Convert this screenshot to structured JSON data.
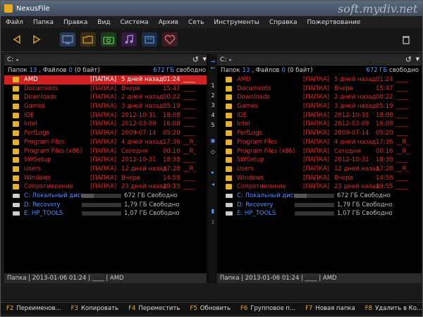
{
  "window": {
    "title": "NexusFile",
    "watermark": "soft.mydiv.net"
  },
  "menu": [
    "Файл",
    "Папка",
    "Правка",
    "Вид",
    "Система",
    "Архив",
    "Сеть",
    "Инструменты",
    "Справка",
    "Пожертвование"
  ],
  "left_panel": {
    "path": "C:",
    "stat": {
      "folders_label": "Папок",
      "folders": "13",
      "files_label": ", Файлов",
      "files": "0",
      "bytes": "(0 байт)",
      "free": "672 ГБ",
      "free_label": "свободно"
    },
    "rows": [
      {
        "name": "AMD",
        "type": "[ПАПКА]",
        "date": "5 дней назад",
        "time": "01:24",
        "attr": "____"
      },
      {
        "name": "Documents",
        "type": "[ПАПКА]",
        "date": "Вчера",
        "time": "15:47",
        "attr": "____"
      },
      {
        "name": "Downloads",
        "type": "[ПАПКА]",
        "date": "2 дней назад",
        "time": "00:22",
        "attr": "____"
      },
      {
        "name": "Games",
        "type": "[ПАПКА]",
        "date": "3 дней назад",
        "time": "05:19",
        "attr": "____"
      },
      {
        "name": "IDE",
        "type": "[ПАПКА]",
        "date": "2012-10-31",
        "time": "18:08",
        "attr": "____"
      },
      {
        "name": "Intel",
        "type": "[ПАПКА]",
        "date": "2012-03-09",
        "time": "16:08",
        "attr": "____"
      },
      {
        "name": "PerfLogs",
        "type": "[ПАПКА]",
        "date": "2009-07-14",
        "time": "05:20",
        "attr": "____"
      },
      {
        "name": "Program Files",
        "type": "[ПАПКА]",
        "date": "4 дней назад",
        "time": "17:36",
        "attr": "__R_"
      },
      {
        "name": "Program Files (x86)",
        "type": "[ПАПКА]",
        "date": "Сегодня",
        "time": "00:16",
        "attr": "__R_"
      },
      {
        "name": "SWSetup",
        "type": "[ПАПКА]",
        "date": "2012-10-31",
        "time": "18:38",
        "attr": "____"
      },
      {
        "name": "Users",
        "type": "[ПАПКА]",
        "date": "12 дней назад",
        "time": "17:28",
        "attr": "__R_"
      },
      {
        "name": "Windows",
        "type": "[ПАПКА]",
        "date": "Вчера",
        "time": "14:58",
        "attr": "____"
      },
      {
        "name": "Сопротивление",
        "type": "[ПАПКА]",
        "date": "23 дней назад",
        "time": "19:55",
        "attr": "____"
      }
    ],
    "drives": [
      {
        "name": "C: Локальный диск",
        "free": "672 ГБ Свободно",
        "used_fraction": 0.3
      },
      {
        "name": "D: Recovery",
        "free": "1,79 ГБ Свободно",
        "used_fraction": 0.0
      },
      {
        "name": "E: HP_TOOLS",
        "free": "1,07 ГБ Свободно",
        "used_fraction": 0.0
      }
    ],
    "footer": "Папка  |  2013-01-06 01:24  |  ____  |  AMD"
  },
  "right_panel": {
    "path": "C:",
    "stat": {
      "folders_label": "Папок",
      "folders": "13",
      "files_label": ", Файлов",
      "files": "0",
      "bytes": "(0 байт)",
      "free": "672 ГБ",
      "free_label": "свободно"
    },
    "rows": [
      {
        "name": "AMD",
        "type": "[ПАПКА]",
        "date": "5 дней назад",
        "time": "01:24",
        "attr": "____"
      },
      {
        "name": "Documents",
        "type": "[ПАПКА]",
        "date": "Вчера",
        "time": "15:47",
        "attr": "____"
      },
      {
        "name": "Downloads",
        "type": "[ПАПКА]",
        "date": "2 дней назад",
        "time": "00:22",
        "attr": "____"
      },
      {
        "name": "Games",
        "type": "[ПАПКА]",
        "date": "3 дней назад",
        "time": "05:19",
        "attr": "____"
      },
      {
        "name": "IDE",
        "type": "[ПАПКА]",
        "date": "2012-10-31",
        "time": "18:08",
        "attr": "____"
      },
      {
        "name": "Intel",
        "type": "[ПАПКА]",
        "date": "2012-03-09",
        "time": "16:08",
        "attr": "____"
      },
      {
        "name": "PerfLogs",
        "type": "[ПАПКА]",
        "date": "2009-07-14",
        "time": "05:20",
        "attr": "____"
      },
      {
        "name": "Program Files",
        "type": "[ПАПКА]",
        "date": "4 дней назад",
        "time": "17:36",
        "attr": "__R_"
      },
      {
        "name": "Program Files (x86)",
        "type": "[ПАПКА]",
        "date": "Сегодня",
        "time": "00:16",
        "attr": "__R_"
      },
      {
        "name": "SWSetup",
        "type": "[ПАПКА]",
        "date": "2012-10-31",
        "time": "18:38",
        "attr": "____"
      },
      {
        "name": "Users",
        "type": "[ПАПКА]",
        "date": "12 дней назад",
        "time": "17:28",
        "attr": "__R_"
      },
      {
        "name": "Windows",
        "type": "[ПАПКА]",
        "date": "Вчера",
        "time": "14:58",
        "attr": "____"
      },
      {
        "name": "Сопротивление",
        "type": "[ПАПКА]",
        "date": "23 дней назад",
        "time": "19:55",
        "attr": "____"
      }
    ],
    "drives": [
      {
        "name": "C: Локальный диск",
        "free": "672 ГБ Свободно",
        "used_fraction": 0.3
      },
      {
        "name": "D: Recovery",
        "free": "1,79 ГБ Свободно",
        "used_fraction": 0.0
      },
      {
        "name": "E: HP_TOOLS",
        "free": "1,07 ГБ Свободно",
        "used_fraction": 0.0
      }
    ],
    "footer": "Папка  |  2013-01-06 01:24  |  ____  |  AMD"
  },
  "middle_bar": [
    "1",
    "2",
    "3",
    "4",
    "5"
  ],
  "fkeys": [
    {
      "key": "F2",
      "label": "Переименов..."
    },
    {
      "key": "F3",
      "label": "Копировать"
    },
    {
      "key": "F4",
      "label": "Переместить"
    },
    {
      "key": "F5",
      "label": "Обновить"
    },
    {
      "key": "F6",
      "label": "Групповое п..."
    },
    {
      "key": "F7",
      "label": "Новая папка"
    },
    {
      "key": "F8",
      "label": "Удалить в Ко..."
    }
  ],
  "colors": {
    "selection": "#d21f1f",
    "folder_text": "#e52a2a",
    "accent_blue": "#5b9bff",
    "fkey": "#e3b030"
  }
}
